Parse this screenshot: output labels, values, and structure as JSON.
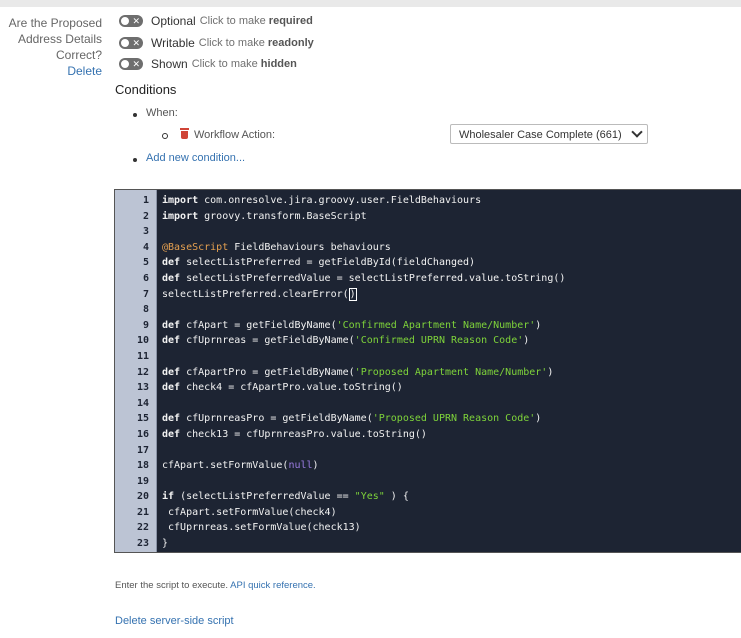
{
  "field": {
    "name_lines": [
      "Are the Proposed",
      "Address Details",
      "Correct?"
    ],
    "delete_label": "Delete"
  },
  "toggles": [
    {
      "label": "Optional",
      "hint_prefix": "Click to make",
      "hint_bold": "required"
    },
    {
      "label": "Writable",
      "hint_prefix": "Click to make",
      "hint_bold": "readonly"
    },
    {
      "label": "Shown",
      "hint_prefix": "Click to make",
      "hint_bold": "hidden"
    }
  ],
  "toggle_icon": "x-icon",
  "conditions": {
    "title": "Conditions",
    "when_label": "When:",
    "workflow_action_label": "Workflow Action:",
    "workflow_action_value": "Wholesaler Case Complete (661)",
    "add_new_label": "Add new condition..."
  },
  "code_lines": [
    [
      {
        "t": "import",
        "c": "kw"
      },
      {
        "t": " com.onresolve.jira.groovy.user.FieldBehaviours",
        "c": ""
      }
    ],
    [
      {
        "t": "import",
        "c": "kw"
      },
      {
        "t": " groovy.transform.BaseScript",
        "c": ""
      }
    ],
    [],
    [
      {
        "t": "@BaseScript",
        "c": "ann"
      },
      {
        "t": " FieldBehaviours behaviours",
        "c": ""
      }
    ],
    [
      {
        "t": "def",
        "c": "kw"
      },
      {
        "t": " selectListPreferred = getFieldById(fieldChanged)",
        "c": ""
      }
    ],
    [
      {
        "t": "def",
        "c": "kw"
      },
      {
        "t": " selectListPreferredValue = selectListPreferred.value.toString()",
        "c": ""
      }
    ],
    [
      {
        "t": "selectListPreferred.clearError(",
        "c": ""
      },
      {
        "t": ")",
        "c": "cur"
      }
    ],
    [],
    [
      {
        "t": "def",
        "c": "kw"
      },
      {
        "t": " cfApart = getFieldByName(",
        "c": ""
      },
      {
        "t": "'Confirmed Apartment Name/Number'",
        "c": "str"
      },
      {
        "t": ")",
        "c": ""
      }
    ],
    [
      {
        "t": "def",
        "c": "kw"
      },
      {
        "t": " cfUprnreas = getFieldByName(",
        "c": ""
      },
      {
        "t": "'Confirmed UPRN Reason Code'",
        "c": "str"
      },
      {
        "t": ")",
        "c": ""
      }
    ],
    [],
    [
      {
        "t": "def",
        "c": "kw"
      },
      {
        "t": " cfApartPro = getFieldByName(",
        "c": ""
      },
      {
        "t": "'Proposed Apartment Name/Number'",
        "c": "str"
      },
      {
        "t": ")",
        "c": ""
      }
    ],
    [
      {
        "t": "def",
        "c": "kw"
      },
      {
        "t": " check4 = cfApartPro.value.toString()",
        "c": ""
      }
    ],
    [],
    [
      {
        "t": "def",
        "c": "kw"
      },
      {
        "t": " cfUprnreasPro = getFieldByName(",
        "c": ""
      },
      {
        "t": "'Proposed UPRN Reason Code'",
        "c": "str"
      },
      {
        "t": ")",
        "c": ""
      }
    ],
    [
      {
        "t": "def",
        "c": "kw"
      },
      {
        "t": " check13 = cfUprnreasPro.value.toString()",
        "c": ""
      }
    ],
    [],
    [
      {
        "t": "cfApart.setFormValue(",
        "c": ""
      },
      {
        "t": "null",
        "c": "nul"
      },
      {
        "t": ")",
        "c": ""
      }
    ],
    [],
    [
      {
        "t": "if",
        "c": "kw"
      },
      {
        "t": " (selectListPreferredValue == ",
        "c": ""
      },
      {
        "t": "\"Yes\"",
        "c": "str"
      },
      {
        "t": " ) {",
        "c": ""
      }
    ],
    [
      {
        "t": " cfApart.setFormValue(check4)",
        "c": ""
      }
    ],
    [
      {
        "t": " cfUprnreas.setFormValue(check13)",
        "c": ""
      }
    ],
    [
      {
        "t": "}",
        "c": ""
      }
    ]
  ],
  "help": {
    "text": "Enter the script to execute.",
    "link": "API quick reference."
  },
  "delete_script_label": "Delete server-side script"
}
